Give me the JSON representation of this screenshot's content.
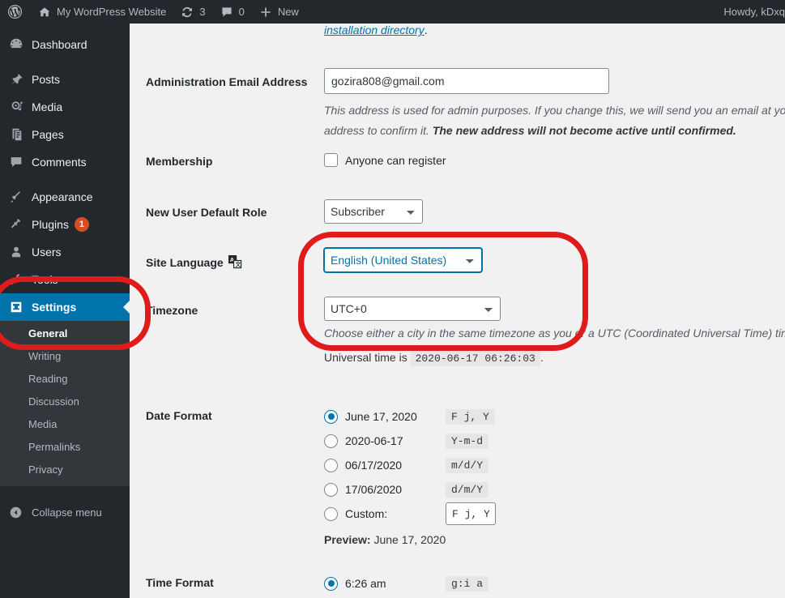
{
  "adminbar": {
    "logo_icon": "wordpress-logo-icon",
    "site_name": "My WordPress Website",
    "home_icon": "home-icon",
    "updates_icon": "updates-icon",
    "updates_count": "3",
    "comments_icon": "comment-icon",
    "comments_count": "0",
    "new_icon": "plus-icon",
    "new_label": "New",
    "howdy": "Howdy, kDxq"
  },
  "sidebar": {
    "items": [
      {
        "label": "Dashboard",
        "icon": "dashboard-icon"
      },
      {
        "label": "Posts",
        "icon": "pin-icon"
      },
      {
        "label": "Media",
        "icon": "media-icon"
      },
      {
        "label": "Pages",
        "icon": "pages-icon"
      },
      {
        "label": "Comments",
        "icon": "comment-icon"
      },
      {
        "label": "Appearance",
        "icon": "appearance-icon"
      },
      {
        "label": "Plugins",
        "icon": "plugins-icon",
        "badge": "1"
      },
      {
        "label": "Users",
        "icon": "users-icon"
      },
      {
        "label": "Tools",
        "icon": "tools-icon"
      },
      {
        "label": "Settings",
        "icon": "settings-icon",
        "current": true
      }
    ],
    "submenu": [
      {
        "label": "General",
        "current": true
      },
      {
        "label": "Writing"
      },
      {
        "label": "Reading"
      },
      {
        "label": "Discussion"
      },
      {
        "label": "Media"
      },
      {
        "label": "Permalinks"
      },
      {
        "label": "Privacy"
      }
    ],
    "collapse_label": "Collapse menu",
    "collapse_icon": "chevron-left-circle-icon"
  },
  "main": {
    "top_link": "installation directory",
    "top_link_suffix": ".",
    "admin_email": {
      "label": "Administration Email Address",
      "value": "gozira808@gmail.com",
      "desc_line1": "This address is used for admin purposes. If you change this, we will send you an email at your n",
      "desc_line2_a": "address to confirm it. ",
      "desc_line2_b": "The new address will not become active until confirmed."
    },
    "membership": {
      "label": "Membership",
      "checkbox_label": "Anyone can register",
      "checked": false
    },
    "default_role": {
      "label": "New User Default Role",
      "value": "Subscriber"
    },
    "site_language": {
      "label": "Site Language",
      "icon": "translate-icon",
      "value": "English (United States)",
      "focused": true
    },
    "timezone": {
      "label": "Timezone",
      "value": "UTC+0",
      "desc": "Choose either a city in the same timezone as you or a UTC (Coordinated Universal Time) time",
      "universal_time_prefix": "Universal time is",
      "universal_time_value": "2020-06-17 06:26:03",
      "universal_time_suffix": "."
    },
    "date_format": {
      "label": "Date Format",
      "options": [
        {
          "display": "June 17, 2020",
          "code": "F j, Y",
          "selected": true
        },
        {
          "display": "2020-06-17",
          "code": "Y-m-d",
          "selected": false
        },
        {
          "display": "06/17/2020",
          "code": "m/d/Y",
          "selected": false
        },
        {
          "display": "17/06/2020",
          "code": "d/m/Y",
          "selected": false
        },
        {
          "display": "Custom:",
          "code": "F j, Y",
          "selected": false,
          "is_custom": true
        }
      ],
      "preview_label": "Preview:",
      "preview_value": "June 17, 2020"
    },
    "time_format": {
      "label": "Time Format",
      "options": [
        {
          "display": "6:26 am",
          "code": "g:i a",
          "selected": true
        }
      ]
    }
  },
  "annotations": {
    "color": "#e01b1b",
    "box_language_timezone": "highlight-box-language-timezone",
    "box_settings_menu": "highlight-box-settings-menu"
  }
}
